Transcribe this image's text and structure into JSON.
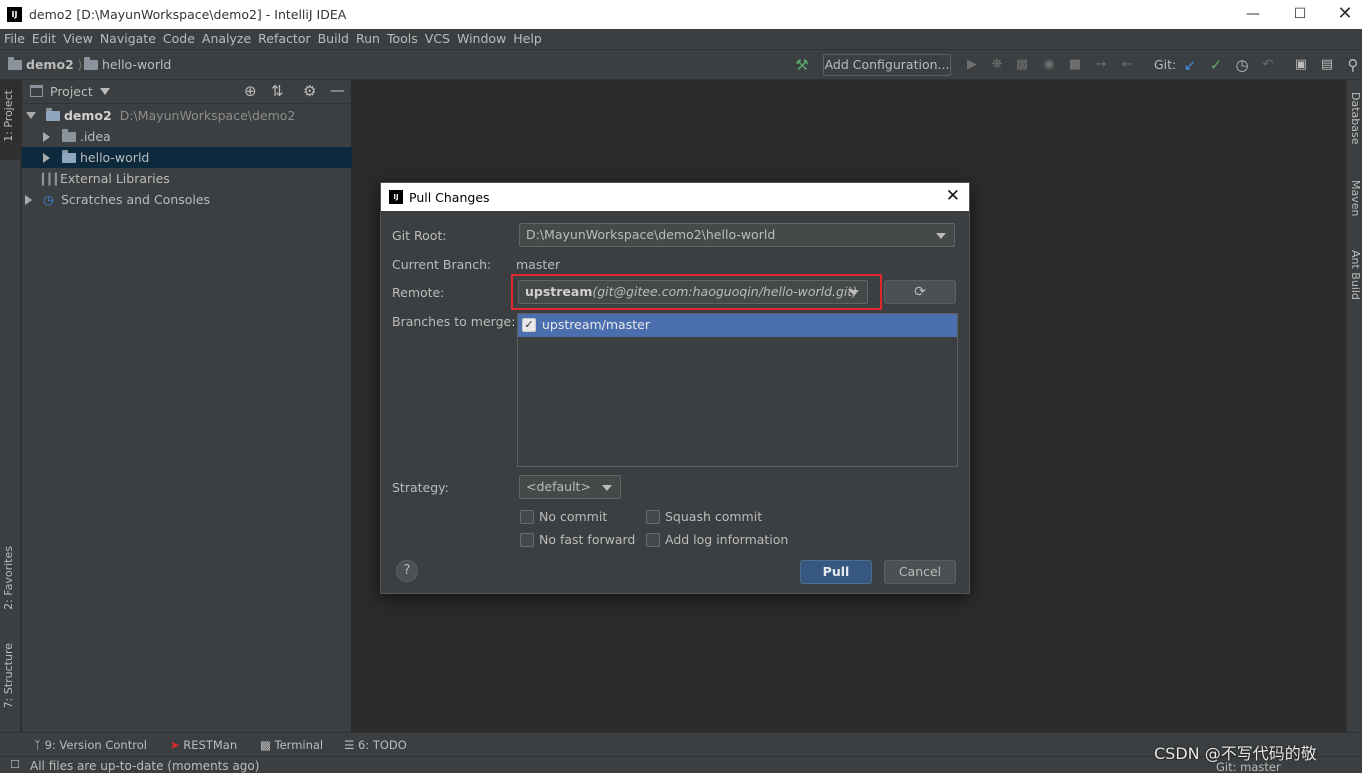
{
  "window": {
    "app_icon": "IJ",
    "title": "demo2 [D:\\MayunWorkspace\\demo2] - IntelliJ IDEA"
  },
  "menu": [
    "File",
    "Edit",
    "View",
    "Navigate",
    "Code",
    "Analyze",
    "Refactor",
    "Build",
    "Run",
    "Tools",
    "VCS",
    "Window",
    "Help"
  ],
  "breadcrumb": {
    "project": "demo2",
    "module": "hello-world"
  },
  "toolbar": {
    "add_configuration": "Add Configuration...",
    "git_label": "Git:"
  },
  "left_tabs": {
    "project": "1: Project",
    "favorites": "2: Favorites",
    "structure": "7: Structure"
  },
  "right_tabs": {
    "database": "Database",
    "maven": "Maven",
    "ant": "Ant Build"
  },
  "project_panel": {
    "header": "Project",
    "tree": [
      {
        "label": "demo2",
        "path": "D:\\MayunWorkspace\\demo2"
      },
      {
        "label": ".idea"
      },
      {
        "label": "hello-world"
      },
      {
        "label": "External Libraries"
      },
      {
        "label": "Scratches and Consoles"
      }
    ]
  },
  "dialog": {
    "icon": "IJ",
    "title": "Pull Changes",
    "git_root_label": "Git Root:",
    "git_root_value": "D:\\MayunWorkspace\\demo2\\hello-world",
    "current_branch_label": "Current Branch:",
    "current_branch_value": "master",
    "remote_label": "Remote:",
    "remote_name": "upstream",
    "remote_url": "(git@gitee.com:haoguoqin/hello-world.git)",
    "branches_label": "Branches to merge:",
    "branches": [
      "upstream/master"
    ],
    "strategy_label": "Strategy:",
    "strategy_value": "<default>",
    "options": {
      "no_commit": "No commit",
      "squash_commit": "Squash commit",
      "no_fast_forward": "No fast forward",
      "add_log": "Add log information"
    },
    "help": "?",
    "pull": "Pull",
    "cancel": "Cancel"
  },
  "tool_windows": {
    "version_control": "9: Version Control",
    "restman": "RESTMan",
    "terminal": "Terminal",
    "todo": "6: TODO"
  },
  "status": {
    "message": "All files are up-to-date (moments ago)",
    "git_branch": "Git: master",
    "watermark": "CSDN @不写代码的敬"
  },
  "colors": {
    "highlight_red": "#e0272b",
    "selection_blue": "#4b6eaf",
    "pull_button": "#365880"
  }
}
